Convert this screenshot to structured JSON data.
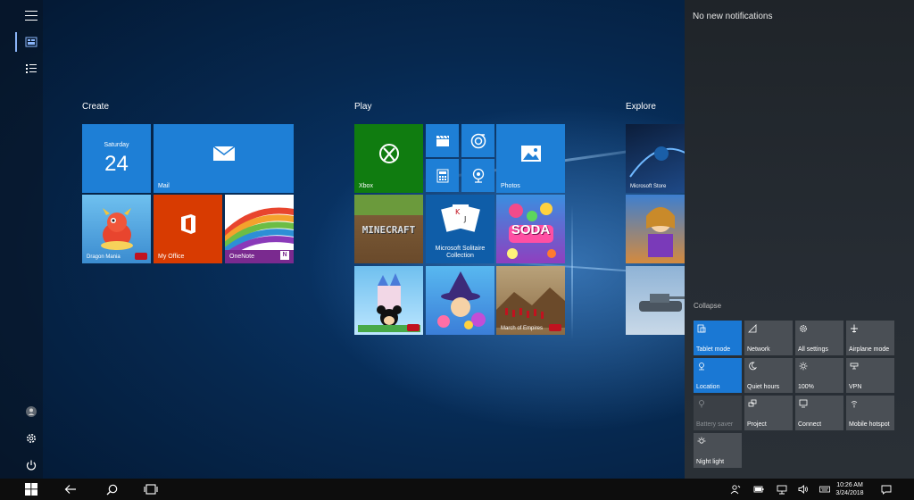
{
  "start": {
    "groups": {
      "create": "Create",
      "play": "Play",
      "explore": "Explore"
    },
    "calendar": {
      "day_name": "Saturday",
      "day_number": "24"
    },
    "tiles": {
      "mail": "Mail",
      "my_office": "My Office",
      "onenote": "OneNote",
      "dragon_mania": "Dragon Mania",
      "xbox": "Xbox",
      "photos": "Photos",
      "minecraft": "MINECRAFT",
      "solitaire": "Microsoft Solitaire Collection",
      "candy_soda": "SODA",
      "march_of_empires": "March of Empires",
      "microsoft_store": "Microsoft Store"
    }
  },
  "action_center": {
    "heading": "No new notifications",
    "collapse": "Collapse",
    "quick_actions": [
      {
        "label": "Tablet mode",
        "state": "on",
        "icon": "tablet-icon"
      },
      {
        "label": "Network",
        "state": "off",
        "icon": "network-icon"
      },
      {
        "label": "All settings",
        "state": "off",
        "icon": "gear-icon"
      },
      {
        "label": "Airplane mode",
        "state": "off",
        "icon": "airplane-icon"
      },
      {
        "label": "Location",
        "state": "on",
        "icon": "location-icon"
      },
      {
        "label": "Quiet hours",
        "state": "off",
        "icon": "moon-icon"
      },
      {
        "label": "100%",
        "state": "off",
        "icon": "brightness-icon"
      },
      {
        "label": "VPN",
        "state": "off",
        "icon": "vpn-icon"
      },
      {
        "label": "Battery saver",
        "state": "disabled",
        "icon": "battery-saver-icon"
      },
      {
        "label": "Project",
        "state": "off",
        "icon": "project-icon"
      },
      {
        "label": "Connect",
        "state": "off",
        "icon": "connect-icon"
      },
      {
        "label": "Mobile hotspot",
        "state": "off",
        "icon": "hotspot-icon"
      },
      {
        "label": "Night light",
        "state": "off",
        "icon": "night-light-icon"
      }
    ]
  },
  "taskbar": {
    "time": "10:26 AM",
    "date": "3/24/2018"
  },
  "colors": {
    "accent": "#1a78d4",
    "tile_blue": "#1e7fd6",
    "office_orange": "#d83b01",
    "xbox_green": "#107c10",
    "annotation_red": "#e0161b"
  }
}
